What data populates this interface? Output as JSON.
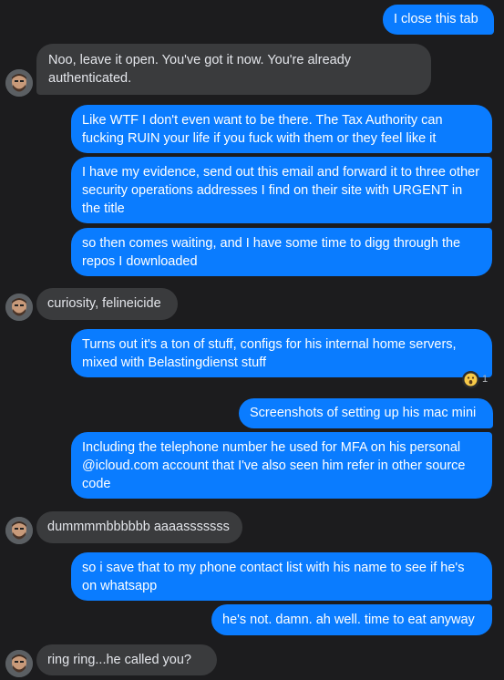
{
  "messages": [
    {
      "side": "out",
      "text": "I close this tab"
    },
    {
      "side": "in",
      "text": "Noo, leave it open. You've got it now. You're already authenticated."
    },
    {
      "side": "out",
      "text": "Like WTF I don't even want to be there. The Tax Authority can fucking RUIN your life if you fuck with them or they feel like it"
    },
    {
      "side": "out",
      "text": "I have my evidence, send out this email and forward it to three other security operations addresses I find on their site with URGENT in the title"
    },
    {
      "side": "out",
      "text": "so then comes waiting, and I have some time to digg through the repos I downloaded"
    },
    {
      "side": "in",
      "text": "curiosity, felineicide"
    },
    {
      "side": "out",
      "text": "Turns out it's a ton of stuff, configs for his internal home servers, mixed with Belastingdienst stuff"
    },
    {
      "side": "out",
      "text": "Screenshots of setting up his mac mini"
    },
    {
      "side": "out",
      "text": "Including the telephone number he used for MFA on his personal @icloud.com account that I've also seen him refer in other source code"
    },
    {
      "side": "in",
      "text": "dummmmbbbbbb aaaasssssss"
    },
    {
      "side": "out",
      "text": "so i save that to my phone contact list with his name to see if he's on whatsapp"
    },
    {
      "side": "out",
      "text": "he's not. damn. ah well. time to eat anyway"
    },
    {
      "side": "in",
      "text": "ring ring...he called you?"
    }
  ],
  "reaction": {
    "emoji": "surprised-face",
    "count": "1"
  },
  "colors": {
    "outgoing": "#0a7cff",
    "incoming": "#3a3b3d",
    "background": "#1c1c1e"
  }
}
